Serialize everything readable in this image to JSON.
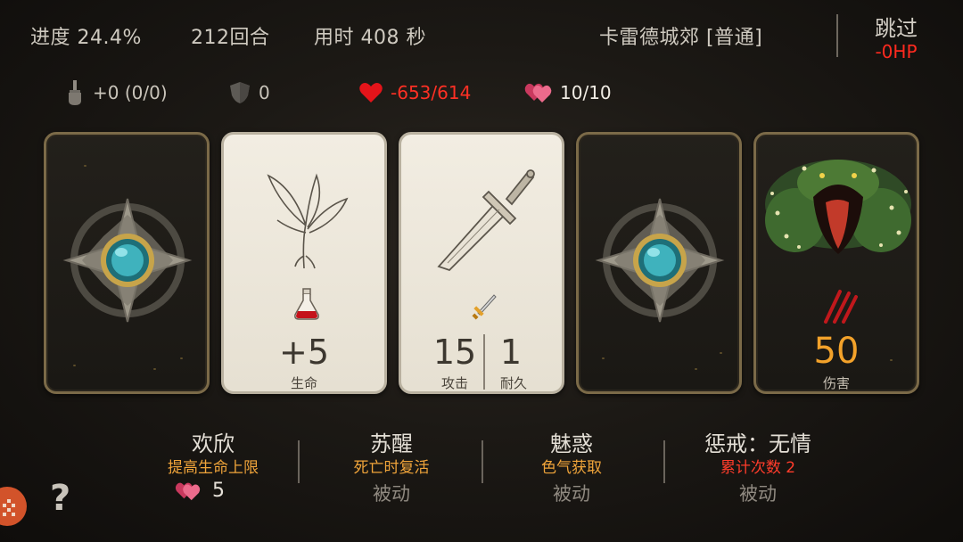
{
  "top": {
    "progress_text": "进度 24.4%",
    "turns_text": "212回合",
    "time_text": "用时 408 秒",
    "location_text": "卡雷德城郊 [普通]",
    "skip_label": "跳过",
    "skip_hp": "-0HP"
  },
  "stats": {
    "attack": "+0 (0/0)",
    "armor": "0",
    "hp": "-653/614",
    "charm": "10/10"
  },
  "cards": {
    "herb": {
      "value": "+5",
      "label": "生命"
    },
    "sword": {
      "attack_value": "15",
      "attack_label": "攻击",
      "durability_value": "1",
      "durability_label": "耐久"
    },
    "monster": {
      "value": "50",
      "label": "伤害"
    }
  },
  "skills": [
    {
      "title": "欢欣",
      "desc": "提高生命上限",
      "charm": "5"
    },
    {
      "title": "苏醒",
      "desc": "死亡时复活",
      "type": "被动"
    },
    {
      "title": "魅惑",
      "desc": "色气获取",
      "type": "被动"
    },
    {
      "title": "惩戒：无情",
      "desc": "累计次数 2",
      "type": "被动"
    }
  ],
  "help_label": "?",
  "colors": {
    "accent_gold": "#f3a22a",
    "hp_red": "#ff3024",
    "skill_orange": "#f0a43a",
    "card_border_dark": "#7b6a48"
  },
  "icons": {
    "attack": "sword-fist-icon",
    "armor": "shield-icon",
    "hp": "heart-icon",
    "charm": "double-heart-icon",
    "potion": "potion-flask-icon",
    "sword_small": "sword-icon",
    "claw": "claw-scratch-icon",
    "gear": "gear-icon",
    "help": "question-icon"
  }
}
